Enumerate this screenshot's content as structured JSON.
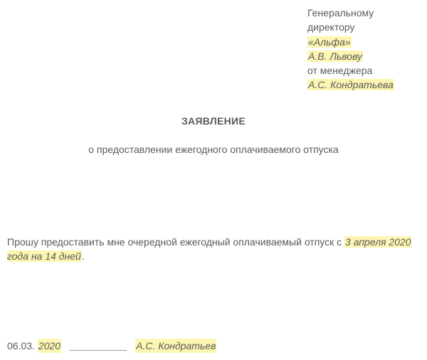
{
  "header": {
    "to_line": "Генеральному директору",
    "company": "«Альфа»",
    "to_name": "А.В. Львову",
    "from_line": "от менеджера",
    "from_name": "А.С. Кондратьева"
  },
  "title": "ЗАЯВЛЕНИЕ",
  "subtitle": "о предоставлении ежегодного оплачиваемого отпуска",
  "body": {
    "prefix": " Прошу предоставить мне очередной ежегодный оплачиваемый отпуск с ",
    "highlight": "3 апреля 2020 года на 14 дней",
    "suffix": "."
  },
  "footer": {
    "date_prefix": "06.03.",
    "date_year": "2020",
    "signature_name": "А.С. Кондратьев"
  }
}
